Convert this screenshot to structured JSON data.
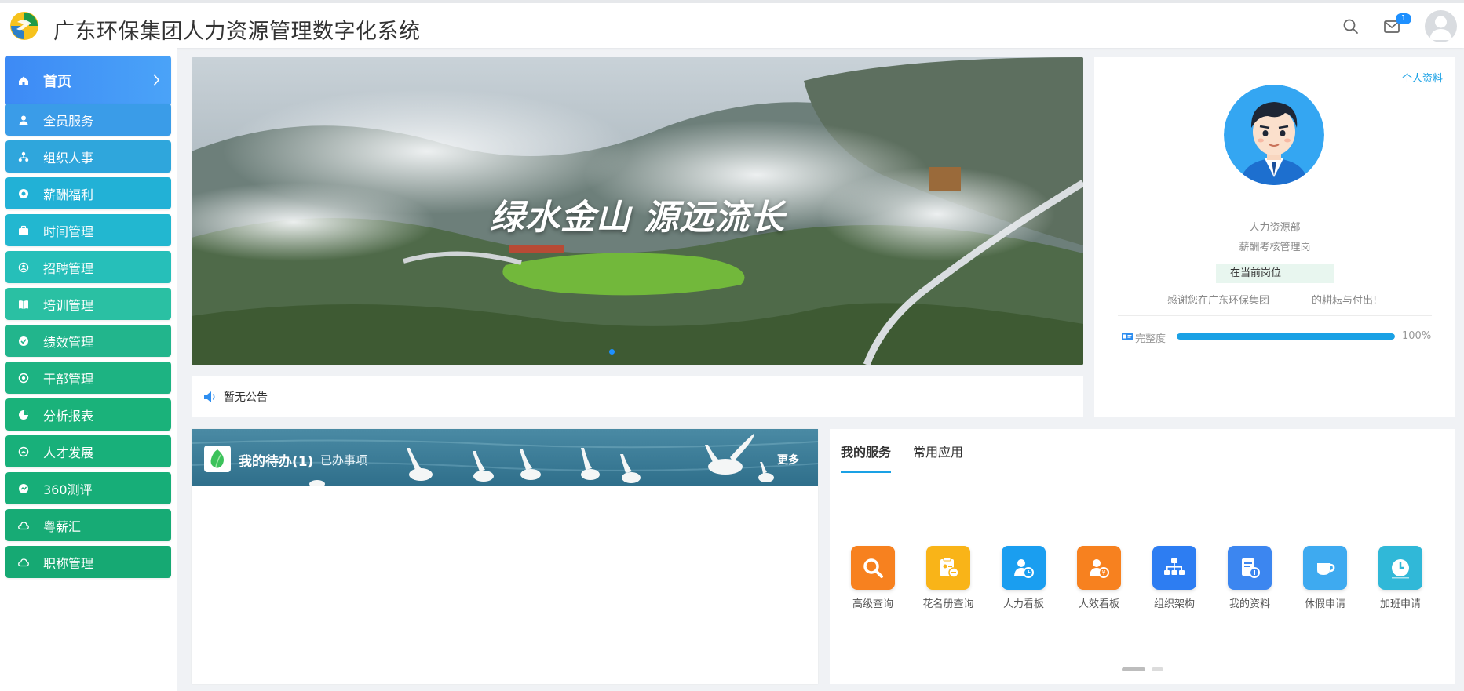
{
  "header": {
    "title": "广东环保集团人力资源管理数字化系统",
    "message_count": "1"
  },
  "sidebar": {
    "items": [
      {
        "label": "首页",
        "icon": "home-icon",
        "color": "#3f8ff5"
      },
      {
        "label": "全员服务",
        "icon": "user-icon",
        "color": "#3a9ce8"
      },
      {
        "label": "组织人事",
        "icon": "org-icon",
        "color": "#2fa6dc"
      },
      {
        "label": "薪酬福利",
        "icon": "coin-icon",
        "color": "#22b1d6"
      },
      {
        "label": "时间管理",
        "icon": "briefcase-icon",
        "color": "#22b7d0"
      },
      {
        "label": "招聘管理",
        "icon": "recruit-icon",
        "color": "#26bfb9"
      },
      {
        "label": "培训管理",
        "icon": "book-icon",
        "color": "#2ac0a3"
      },
      {
        "label": "绩效管理",
        "icon": "check-icon",
        "color": "#22b58c"
      },
      {
        "label": "干部管理",
        "icon": "badge-icon",
        "color": "#1db382"
      },
      {
        "label": "分析报表",
        "icon": "chart-icon",
        "color": "#1ab27a"
      },
      {
        "label": "人才发展",
        "icon": "talent-icon",
        "color": "#18b07a"
      },
      {
        "label": "360测评",
        "icon": "rating-icon",
        "color": "#17ae78"
      },
      {
        "label": "粤薪汇",
        "icon": "cloud-icon",
        "color": "#17ab75"
      },
      {
        "label": "职称管理",
        "icon": "cloud-icon",
        "color": "#16a973"
      }
    ]
  },
  "banner": {
    "slogan": "绿水金山 源远流长"
  },
  "notice": {
    "text": "暂无公告"
  },
  "profile": {
    "link": "个人资料",
    "department": "人力资源部",
    "position": "薪酬考核管理岗",
    "status": "在当前岗位",
    "thanks_left": "感谢您在广东环保集团",
    "thanks_right": "的耕耘与付出!",
    "completeness_label": "完整度",
    "completeness_value": 1.0,
    "completeness_text": "100%"
  },
  "todo": {
    "title": "我的待办(1)",
    "done": "已办事项",
    "more": "更多"
  },
  "services": {
    "tabs": [
      "我的服务",
      "常用应用"
    ],
    "items": [
      {
        "label": "高级查询",
        "icon": "search-icon",
        "color": "#f7811f"
      },
      {
        "label": "花名册查询",
        "icon": "roster-icon",
        "color": "#f9b418"
      },
      {
        "label": "人力看板",
        "icon": "person-dashboard-icon",
        "color": "#1a9ef0"
      },
      {
        "label": "人效看板",
        "icon": "person-efficiency-icon",
        "color": "#f7811f"
      },
      {
        "label": "组织架构",
        "icon": "org-chart-icon",
        "color": "#2d7df2"
      },
      {
        "label": "我的资料",
        "icon": "document-icon",
        "color": "#3c86f0"
      },
      {
        "label": "休假申请",
        "icon": "cup-icon",
        "color": "#3eaaf0"
      },
      {
        "label": "加班申请",
        "icon": "clock-icon",
        "color": "#30b8d8"
      }
    ]
  }
}
